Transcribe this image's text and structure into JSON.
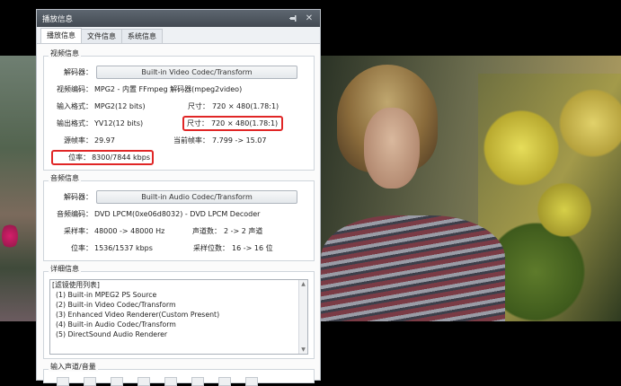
{
  "panel": {
    "title": "播放信息",
    "tabs": [
      "播放信息",
      "文件信息",
      "系统信息"
    ]
  },
  "video": {
    "section": "视频信息",
    "decoder_label": "解码器：",
    "decoder_value": "Built-in Video Codec/Transform",
    "codec_label": "视频编码：",
    "codec_value": "MPG2 - 内置 FFmpeg 解码器(mpeg2video)",
    "input_label": "输入格式：",
    "input_value": "MPG2(12 bits)",
    "input_size_label": "尺寸：",
    "input_size_value": "720 × 480(1.78:1)",
    "output_label": "输出格式：",
    "output_value": "YV12(12 bits)",
    "output_size_label": "尺寸：",
    "output_size_value": "720 × 480(1.78:1)",
    "src_fps_label": "源帧率：",
    "src_fps_value": "29.97",
    "cur_fps_label": "当前帧率：",
    "cur_fps_value": "7.799 -> 15.07",
    "bitrate_label": "位率：",
    "bitrate_value": "8300/7844 kbps"
  },
  "audio": {
    "section": "音频信息",
    "decoder_label": "解码器：",
    "decoder_value": "Built-in Audio Codec/Transform",
    "codec_label": "音频编码：",
    "codec_value": "DVD LPCM(0xe06d8032) - DVD LPCM Decoder",
    "sample_label": "采样率：",
    "sample_value": "48000 -> 48000 Hz",
    "channels_label": "声道数：",
    "channels_value": "2 -> 2 声道",
    "bitrate_label": "位率：",
    "bitrate_value": "1536/1537 kbps",
    "bits_label": "采样位数：",
    "bits_value": "16 -> 16 位"
  },
  "details": {
    "section": "详细信息",
    "items": [
      "[滤镜使用列表]",
      "(1) Built-in MPEG2 PS Source",
      "(2) Built-in Video Codec/Transform",
      "(3) Enhanced Video Renderer(Custom Present)",
      "(4) Built-in Audio Codec/Transform",
      "(5) DirectSound Audio Renderer"
    ]
  },
  "input_volume": {
    "section": "输入声道/音量"
  },
  "colors": {
    "highlight": "#e02626",
    "titlebar": "#4b535b"
  }
}
